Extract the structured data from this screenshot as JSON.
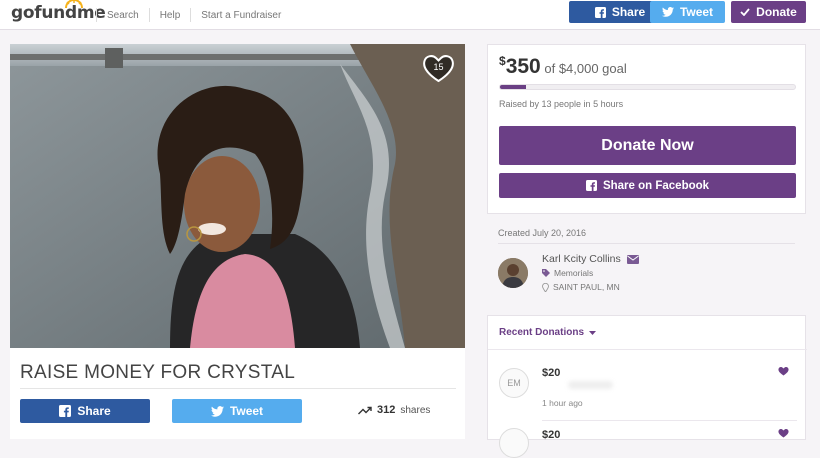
{
  "header": {
    "logo": "gofundme",
    "nav": [
      "Search",
      "Help",
      "Start a Fundraiser"
    ],
    "share_label": "Share",
    "tweet_label": "Tweet",
    "donate_label": "Donate"
  },
  "campaign": {
    "title": "RAISE MONEY FOR CRYSTAL",
    "heart_count": "15",
    "share_label": "Share",
    "tweet_label": "Tweet",
    "shares_count": "312",
    "shares_label": "shares"
  },
  "funding": {
    "raised": "350",
    "goal_text": "of $4,000 goal",
    "progress_fraction": 0.0875,
    "raised_by": "Raised by 13 people in 5 hours",
    "donate_now_label": "Donate Now",
    "share_facebook_label": "Share on Facebook"
  },
  "organizer": {
    "created": "Created July 20, 2016",
    "name": "Karl Kcity Collins",
    "category": "Memorials",
    "location": "SAINT PAUL, MN"
  },
  "donations": {
    "header": "Recent Donations",
    "items": [
      {
        "initials": "EM",
        "amount": "$20",
        "time": "1 hour ago"
      },
      {
        "initials": "",
        "amount": "$20",
        "time": ""
      }
    ]
  },
  "colors": {
    "purple": "#6b3f86",
    "facebook": "#3b5998",
    "twitter": "#55acee",
    "header_share": "#2e5aa0"
  }
}
